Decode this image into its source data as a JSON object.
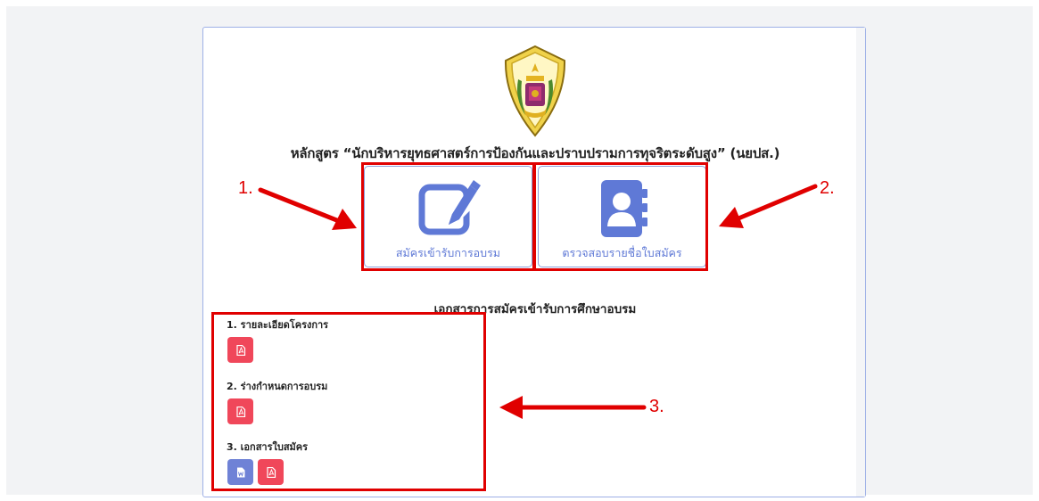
{
  "course_title": "หลักสูตร “นักบริหารยุทธศาสตร์การป้องกันและปราบปรามการทุจริตระดับสูง” (นยปส.)",
  "tiles": {
    "register": {
      "label": "สมัครเข้ารับการอบรม",
      "icon": "edit-icon"
    },
    "check": {
      "label": "ตรวจสอบรายชื่อใบสมัคร",
      "icon": "contact-book-icon"
    }
  },
  "documents": {
    "heading": "เอกสารการสมัครเข้ารับการศึกษาอบรม",
    "items": [
      {
        "title": "1. รายละเอียดโครงการ",
        "buttons": [
          "pdf"
        ]
      },
      {
        "title": "2. ร่างกำหนดการอบรม",
        "buttons": [
          "pdf"
        ]
      },
      {
        "title": "3. เอกสารใบสมัคร",
        "buttons": [
          "word",
          "pdf"
        ]
      }
    ]
  },
  "annotations": {
    "one": "1.",
    "two": "2.",
    "three": "3."
  },
  "colors": {
    "accent": "#5f79d6",
    "annotation_red": "#e00000",
    "pdf_button": "#f0475a",
    "word_button": "#6f82d6"
  }
}
